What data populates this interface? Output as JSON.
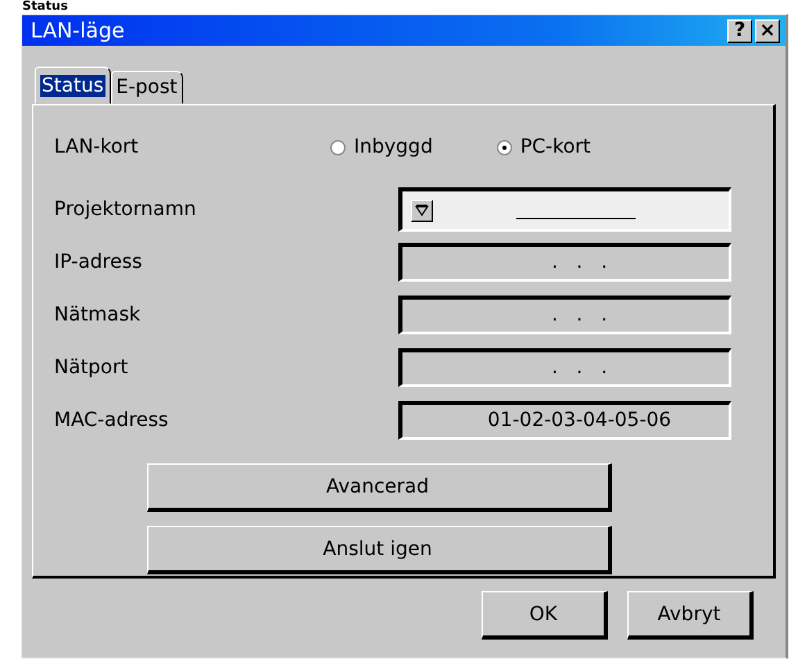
{
  "heading": "Status",
  "window": {
    "title": "LAN-läge",
    "title_buttons": [
      "?",
      "×"
    ]
  },
  "tabs": [
    {
      "label": "Status",
      "selected": true
    },
    {
      "label": "E-post",
      "selected": false
    }
  ],
  "lan_card": {
    "label": "LAN-kort",
    "options": [
      {
        "label": "Inbyggd",
        "selected": false
      },
      {
        "label": "PC-kort",
        "selected": true
      }
    ]
  },
  "fields": [
    {
      "kind": "name",
      "label": "Projektornamn"
    },
    {
      "kind": "text",
      "label": "IP-adress",
      "value": ".   .   ."
    },
    {
      "kind": "text",
      "label": "Nätmask",
      "value": ".   .   ."
    },
    {
      "kind": "text",
      "label": "Nätport",
      "value": ".   .   ."
    },
    {
      "kind": "text",
      "label": "MAC-adress",
      "value": "01-02-03-04-05-06"
    }
  ],
  "actions": [
    "Avancerad",
    "Anslut igen"
  ],
  "buttons": [
    "OK",
    "Avbryt"
  ]
}
